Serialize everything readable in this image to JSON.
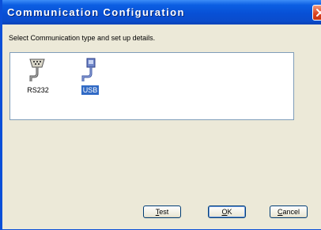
{
  "window": {
    "title": "Communication Configuration",
    "close_icon": "close-icon"
  },
  "instruction": "Select Communication type and set up details.",
  "communication_types": [
    {
      "label": "RS232",
      "icon": "serial-cable-icon",
      "selected": false
    },
    {
      "label": "USB",
      "icon": "usb-cable-icon",
      "selected": true
    }
  ],
  "buttons": {
    "test": "Test",
    "ok": "OK",
    "cancel": "Cancel"
  },
  "colors": {
    "titlebar": "#0750d6",
    "selection": "#316ac5",
    "dialog_bg": "#ece9d8"
  }
}
